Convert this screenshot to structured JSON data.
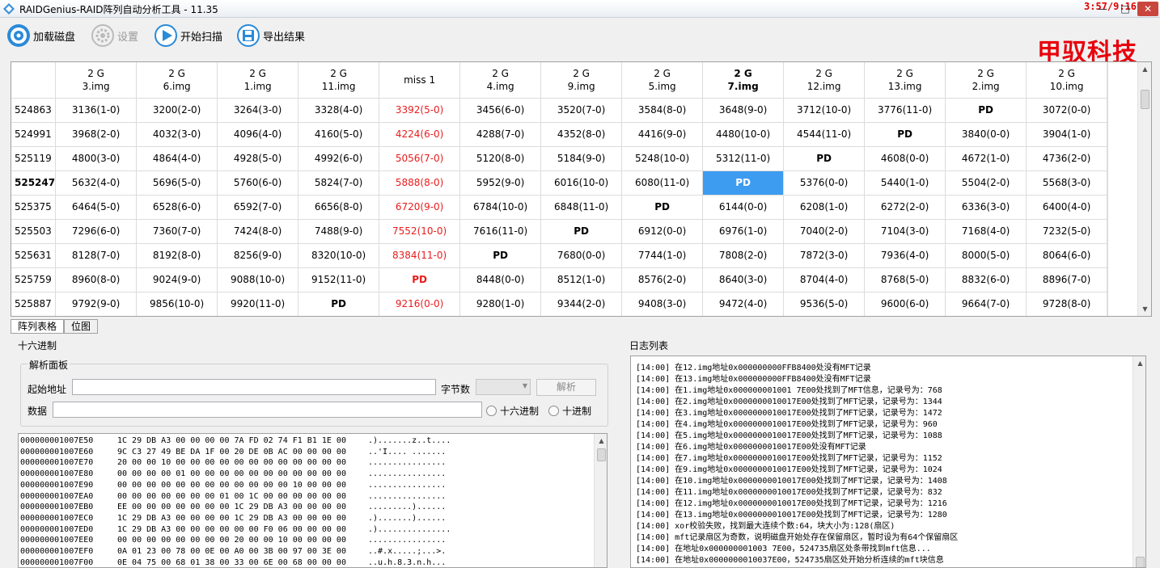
{
  "window": {
    "title": "RAIDGenius-RAID阵列自动分析工具 - 11.35",
    "clock": "3:57/9:16",
    "controls": [
      "—",
      "□",
      "✕"
    ]
  },
  "toolbar": {
    "load_disk": "加载磁盘",
    "settings": "设置",
    "start_scan": "开始扫描",
    "export": "导出结果",
    "brand": "甲驭科技"
  },
  "grid": {
    "columns": [
      {
        "size": "2 G",
        "name": "3.img",
        "bold": false
      },
      {
        "size": "2 G",
        "name": "6.img",
        "bold": false
      },
      {
        "size": "2 G",
        "name": "1.img",
        "bold": false
      },
      {
        "size": "2 G",
        "name": "11.img",
        "bold": false
      },
      {
        "size": "",
        "name": "miss 1",
        "bold": false
      },
      {
        "size": "2 G",
        "name": "4.img",
        "bold": false
      },
      {
        "size": "2 G",
        "name": "9.img",
        "bold": false
      },
      {
        "size": "2 G",
        "name": "5.img",
        "bold": false
      },
      {
        "size": "2 G",
        "name": "7.img",
        "bold": true
      },
      {
        "size": "2 G",
        "name": "12.img",
        "bold": false
      },
      {
        "size": "2 G",
        "name": "13.img",
        "bold": false
      },
      {
        "size": "2 G",
        "name": "2.img",
        "bold": false
      },
      {
        "size": "2 G",
        "name": "10.img",
        "bold": false
      }
    ],
    "rows": [
      {
        "head": "524863",
        "bold": false,
        "cells": [
          "3136(1-0)",
          "3200(2-0)",
          "3264(3-0)",
          "3328(4-0)",
          "3392(5-0)",
          "3456(6-0)",
          "3520(7-0)",
          "3584(8-0)",
          "3648(9-0)",
          "3712(10-0)",
          "3776(11-0)",
          "PD",
          "3072(0-0)"
        ]
      },
      {
        "head": "524991",
        "bold": false,
        "cells": [
          "3968(2-0)",
          "4032(3-0)",
          "4096(4-0)",
          "4160(5-0)",
          "4224(6-0)",
          "4288(7-0)",
          "4352(8-0)",
          "4416(9-0)",
          "4480(10-0)",
          "4544(11-0)",
          "PD",
          "3840(0-0)",
          "3904(1-0)"
        ]
      },
      {
        "head": "525119",
        "bold": false,
        "cells": [
          "4800(3-0)",
          "4864(4-0)",
          "4928(5-0)",
          "4992(6-0)",
          "5056(7-0)",
          "5120(8-0)",
          "5184(9-0)",
          "5248(10-0)",
          "5312(11-0)",
          "PD",
          "4608(0-0)",
          "4672(1-0)",
          "4736(2-0)"
        ]
      },
      {
        "head": "525247",
        "bold": true,
        "cells": [
          "5632(4-0)",
          "5696(5-0)",
          "5760(6-0)",
          "5824(7-0)",
          "5888(8-0)",
          "5952(9-0)",
          "6016(10-0)",
          "6080(11-0)",
          "PD",
          "5376(0-0)",
          "5440(1-0)",
          "5504(2-0)",
          "5568(3-0)"
        ]
      },
      {
        "head": "525375",
        "bold": false,
        "cells": [
          "6464(5-0)",
          "6528(6-0)",
          "6592(7-0)",
          "6656(8-0)",
          "6720(9-0)",
          "6784(10-0)",
          "6848(11-0)",
          "PD",
          "6144(0-0)",
          "6208(1-0)",
          "6272(2-0)",
          "6336(3-0)",
          "6400(4-0)"
        ]
      },
      {
        "head": "525503",
        "bold": false,
        "cells": [
          "7296(6-0)",
          "7360(7-0)",
          "7424(8-0)",
          "7488(9-0)",
          "7552(10-0)",
          "7616(11-0)",
          "PD",
          "6912(0-0)",
          "6976(1-0)",
          "7040(2-0)",
          "7104(3-0)",
          "7168(4-0)",
          "7232(5-0)"
        ]
      },
      {
        "head": "525631",
        "bold": false,
        "cells": [
          "8128(7-0)",
          "8192(8-0)",
          "8256(9-0)",
          "8320(10-0)",
          "8384(11-0)",
          "PD",
          "7680(0-0)",
          "7744(1-0)",
          "7808(2-0)",
          "7872(3-0)",
          "7936(4-0)",
          "8000(5-0)",
          "8064(6-0)"
        ]
      },
      {
        "head": "525759",
        "bold": false,
        "cells": [
          "8960(8-0)",
          "9024(9-0)",
          "9088(10-0)",
          "9152(11-0)",
          "PD",
          "8448(0-0)",
          "8512(1-0)",
          "8576(2-0)",
          "8640(3-0)",
          "8704(4-0)",
          "8768(5-0)",
          "8832(6-0)",
          "8896(7-0)"
        ]
      },
      {
        "head": "525887",
        "bold": false,
        "cells": [
          "9792(9-0)",
          "9856(10-0)",
          "9920(11-0)",
          "PD",
          "9216(0-0)",
          "9280(1-0)",
          "9344(2-0)",
          "9408(3-0)",
          "9472(4-0)",
          "9536(5-0)",
          "9600(6-0)",
          "9664(7-0)",
          "9728(8-0)"
        ]
      }
    ],
    "missing_column_index": 4,
    "selected": {
      "row": 3,
      "col": 8
    },
    "colors": {
      "missing": "#e81c1c",
      "selected_bg": "#3d9bf0"
    }
  },
  "tabs": [
    "阵列表格",
    "位图"
  ],
  "hex_section": {
    "title": "十六进制",
    "panel_title": "解析面板",
    "start_addr_label": "起始地址",
    "bytes_label": "字节数",
    "parse_button": "解析",
    "data_label": "数据",
    "radio_hex": "十六进制",
    "radio_dec": "十进制",
    "lines": [
      {
        "addr": "000000001007E50",
        "hex": "1C 29 DB A3 00 00 00 00 7A FD 02 74 F1 B1 1E 00",
        "ascii": ".).......z..t...."
      },
      {
        "addr": "000000001007E60",
        "hex": "9C C3 27 49 BE DA 1F 00 20 DE 0B AC 00 00 00 00",
        "ascii": "..'I.... ......."
      },
      {
        "addr": "000000001007E70",
        "hex": "20 00 00 10 00 00 00 00 00 00 00 00 00 00 00 00",
        "ascii": "................"
      },
      {
        "addr": "000000001007E80",
        "hex": "00 00 00 00 01 00 00 00 00 00 00 00 00 00 00 00",
        "ascii": "................"
      },
      {
        "addr": "000000001007E90",
        "hex": "00 00 00 00 00 00 00 00 00 00 00 00 10 00 00 00",
        "ascii": "................"
      },
      {
        "addr": "000000001007EA0",
        "hex": "00 00 00 00 00 00 00 01 00 1C 00 00 00 00 00 00",
        "ascii": "................"
      },
      {
        "addr": "000000001007EB0",
        "hex": "EE 00 00 00 00 00 00 00 1C 29 DB A3 00 00 00 00",
        "ascii": ".........)......"
      },
      {
        "addr": "000000001007EC0",
        "hex": "1C 29 DB A3 00 00 00 00 1C 29 DB A3 00 00 00 00",
        "ascii": ".).......)......"
      },
      {
        "addr": "000000001007ED0",
        "hex": "1C 29 DB A3 00 00 00 00 00 00 F0 06 00 00 00 00",
        "ascii": ".)..............."
      },
      {
        "addr": "000000001007EE0",
        "hex": "00 00 00 00 00 00 00 00 20 00 00 10 00 00 00 00",
        "ascii": "................"
      },
      {
        "addr": "000000001007EF0",
        "hex": "0A 01 23 00 78 00 0E 00 A0 00 3B 00 97 00 3E 00",
        "ascii": "..#.x.....;...>."
      },
      {
        "addr": "000000001007F00",
        "hex": "0E 04 75 00 68 01 38 00 33 00 6E 00 68 00 00 00",
        "ascii": "..u.h.8.3.n.h..."
      }
    ]
  },
  "log_section": {
    "title": "日志列表",
    "lines": [
      "[14:00] 在12.img地址0x000000000FFB8400处没有MFT记录",
      "[14:00] 在13.img地址0x000000000FFB8400处没有MFT记录",
      "[14:00] 在1.img地址0x000000001001 7E00处找到了MFT信息，记录号为：768",
      "[14:00] 在2.img地址0x0000000010017E00处找到了MFT记录，记录号为：1344",
      "[14:00] 在3.img地址0x0000000010017E00处找到了MFT记录，记录号为：1472",
      "[14:00] 在4.img地址0x0000000010017E00处找到了MFT记录，记录号为：960",
      "[14:00] 在5.img地址0x0000000010017E00处找到了MFT记录，记录号为：1088",
      "[14:00] 在6.img地址0x0000000010017E00处没有MFT记录",
      "[14:00] 在7.img地址0x0000000010017E00处找到了MFT记录，记录号为：1152",
      "[14:00] 在9.img地址0x0000000010017E00处找到了MFT记录，记录号为：1024",
      "[14:00] 在10.img地址0x0000000010017E00处找到了MFT记录，记录号为：1408",
      "[14:00] 在11.img地址0x0000000010017E00处找到了MFT记录，记录号为：832",
      "[14:00] 在12.img地址0x0000000010017E00处找到了MFT记录，记录号为：1216",
      "[14:00] 在13.img地址0x0000000010017E00处找到了MFT记录，记录号为：1280",
      "[14:00] xor校验失败，找到最大连续个数:64，块大小为:128(扇区)",
      "[14:00] mft记录扇区为奇数，说明磁盘开始处存在保留扇区，暂时设为有64个保留扇区",
      "[14:00] 在地址0x000000001003 7E00，524735扇区处条带找到mft信息...",
      "[14:00] 在地址0x0000000010037E00，524735扇区处开始分析连续的mft块信息"
    ]
  }
}
